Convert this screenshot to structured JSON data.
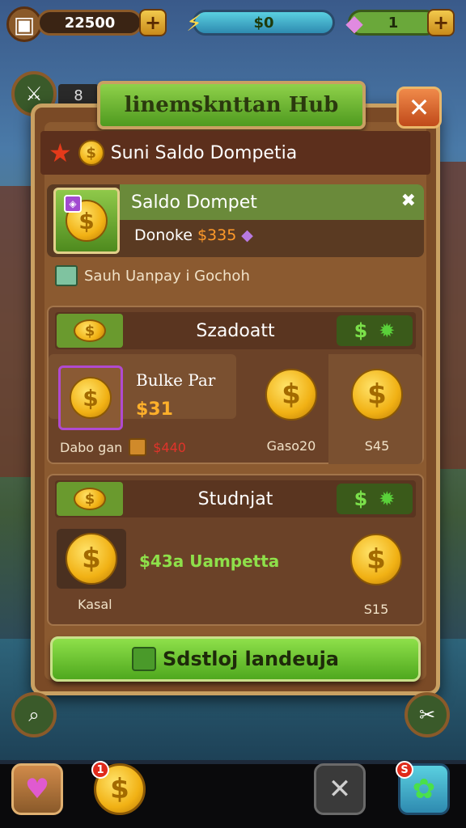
{
  "hud": {
    "coins": "22500",
    "energy": "$0",
    "gems": "1",
    "plus": "+"
  },
  "side_label": "8",
  "panel": {
    "title": "linemsknttan Hub",
    "header": "Suni Saldo Dompetia",
    "close": "✕"
  },
  "saldo": {
    "title": "Saldo Dompet",
    "balance_label": "Donoke",
    "balance_value": "$335",
    "close": "✖"
  },
  "note": "Sauh Uanpay i Gochoh",
  "section1": {
    "title": "Szadoatt",
    "badge": "$",
    "bundle": {
      "title": "Bulke Par",
      "price": "$31",
      "caption": "Dabo gan",
      "price2": "$440"
    },
    "items": [
      {
        "label": "Gaso20"
      },
      {
        "label": "S45"
      }
    ]
  },
  "section2": {
    "title": "Studnjat",
    "badge": "$",
    "item1_label": "Kasal",
    "promo": "$43a Uampetta",
    "item2_label": "S15"
  },
  "cta": "Sdstloj landeuja",
  "nav": {
    "coin_badge": "1",
    "shop_badge": "S"
  }
}
